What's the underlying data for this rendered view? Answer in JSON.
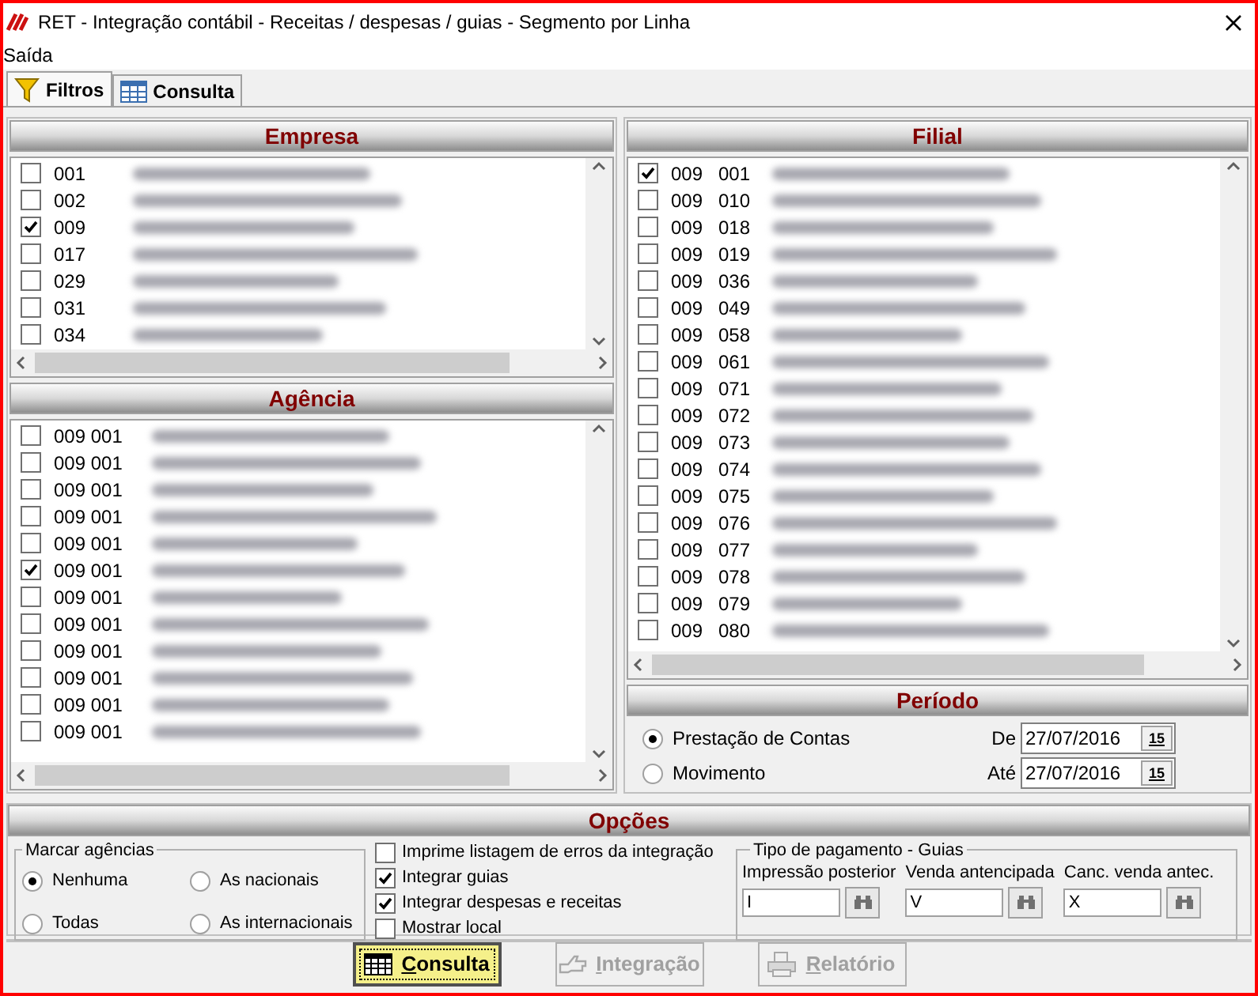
{
  "window": {
    "title": "RET - Integração contábil - Receitas / despesas / guias - Segmento por Linha"
  },
  "menu": [
    "Saída"
  ],
  "tabs": [
    {
      "label": "Filtros",
      "selected": true,
      "kind": "filter"
    },
    {
      "label": "Consulta",
      "selected": false,
      "kind": "table"
    }
  ],
  "empresa": {
    "title": "Empresa",
    "rows": [
      {
        "code": "001",
        "checked": false
      },
      {
        "code": "002",
        "checked": false
      },
      {
        "code": "009",
        "checked": true
      },
      {
        "code": "017",
        "checked": false
      },
      {
        "code": "029",
        "checked": false
      },
      {
        "code": "031",
        "checked": false
      },
      {
        "code": "034",
        "checked": false
      }
    ]
  },
  "agencia": {
    "title": "Agência",
    "rows": [
      {
        "code": "009 001",
        "checked": false
      },
      {
        "code": "009 001",
        "checked": false
      },
      {
        "code": "009 001",
        "checked": false
      },
      {
        "code": "009 001",
        "checked": false
      },
      {
        "code": "009 001",
        "checked": false
      },
      {
        "code": "009 001",
        "checked": true
      },
      {
        "code": "009 001",
        "checked": false
      },
      {
        "code": "009 001",
        "checked": false
      },
      {
        "code": "009 001",
        "checked": false
      },
      {
        "code": "009 001",
        "checked": false
      },
      {
        "code": "009 001",
        "checked": false
      },
      {
        "code": "009 001",
        "checked": false
      }
    ]
  },
  "filial": {
    "title": "Filial",
    "rows": [
      {
        "company": "009",
        "code": "001",
        "checked": true
      },
      {
        "company": "009",
        "code": "010",
        "checked": false
      },
      {
        "company": "009",
        "code": "018",
        "checked": false
      },
      {
        "company": "009",
        "code": "019",
        "checked": false
      },
      {
        "company": "009",
        "code": "036",
        "checked": false
      },
      {
        "company": "009",
        "code": "049",
        "checked": false
      },
      {
        "company": "009",
        "code": "058",
        "checked": false
      },
      {
        "company": "009",
        "code": "061",
        "checked": false
      },
      {
        "company": "009",
        "code": "071",
        "checked": false
      },
      {
        "company": "009",
        "code": "072",
        "checked": false
      },
      {
        "company": "009",
        "code": "073",
        "checked": false
      },
      {
        "company": "009",
        "code": "074",
        "checked": false
      },
      {
        "company": "009",
        "code": "075",
        "checked": false
      },
      {
        "company": "009",
        "code": "076",
        "checked": false
      },
      {
        "company": "009",
        "code": "077",
        "checked": false
      },
      {
        "company": "009",
        "code": "078",
        "checked": false
      },
      {
        "company": "009",
        "code": "079",
        "checked": false
      },
      {
        "company": "009",
        "code": "080",
        "checked": false
      }
    ]
  },
  "periodo": {
    "title": "Período",
    "options": [
      {
        "label": "Prestação de Contas",
        "selected": true
      },
      {
        "label": "Movimento",
        "selected": false
      }
    ],
    "dates": [
      {
        "label": "De",
        "value": "27/07/2016",
        "calendar_label": "15"
      },
      {
        "label": "Até",
        "value": "27/07/2016",
        "calendar_label": "15"
      }
    ]
  },
  "opcoes": {
    "title": "Opções",
    "marcar": {
      "title": "Marcar agências",
      "options": [
        {
          "label": "Nenhuma",
          "selected": true
        },
        {
          "label": "As nacionais",
          "selected": false
        },
        {
          "label": "Todas",
          "selected": false
        },
        {
          "label": "As internacionais",
          "selected": false
        }
      ]
    },
    "checks": [
      {
        "label": "Imprime listagem de erros da integração",
        "checked": false
      },
      {
        "label": "Integrar guias",
        "checked": true
      },
      {
        "label": "Integrar despesas e receitas",
        "checked": true
      },
      {
        "label": "Mostrar local",
        "checked": false
      }
    ],
    "pagamento": {
      "title": "Tipo de pagamento - Guias",
      "fields": [
        {
          "label": "Impressão posterior",
          "value": "I"
        },
        {
          "label": "Venda antencipada",
          "value": "V"
        },
        {
          "label": "Canc. venda antec.",
          "value": "X"
        }
      ]
    }
  },
  "buttons": [
    {
      "label": "Consulta",
      "kind": "table",
      "disabled": false,
      "focused": true
    },
    {
      "label": "Integração",
      "kind": "hand",
      "disabled": true,
      "focused": false
    },
    {
      "label": "Relatório",
      "kind": "printer",
      "disabled": true,
      "focused": false
    }
  ]
}
